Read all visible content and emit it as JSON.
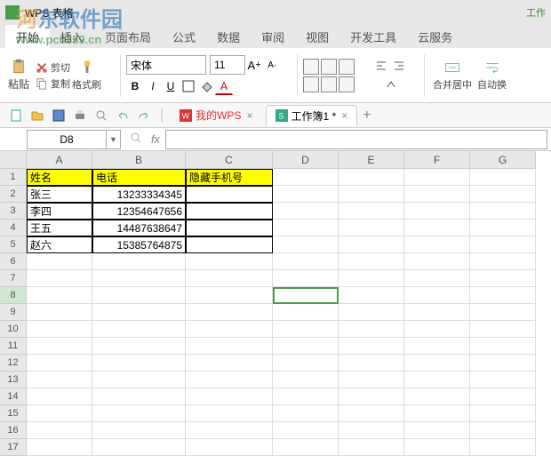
{
  "app": {
    "title": "WPS 表格",
    "topRight": "工作"
  },
  "watermark": {
    "title_pre": "河",
    "title_mid": "东软件园",
    "url": "www.pc0359.cn"
  },
  "ribbon": {
    "tabs": [
      "开始",
      "插入",
      "页面布局",
      "公式",
      "数据",
      "审阅",
      "视图",
      "开发工具",
      "云服务"
    ],
    "activeTab": 0,
    "paste": "粘贴",
    "cut": "剪切",
    "copy": "复制",
    "formatPainter": "格式刷",
    "fontName": "宋体",
    "fontSize": "11",
    "merge": "合并居中",
    "wrap": "自动换"
  },
  "docTabs": {
    "wps": "我的WPS",
    "active": "工作簿1 *"
  },
  "nameBox": "D8",
  "columns": [
    "A",
    "B",
    "C",
    "D",
    "E",
    "F",
    "G"
  ],
  "rowCount": 17,
  "headerRow": {
    "a": "姓名",
    "b": "电话",
    "c": "隐藏手机号"
  },
  "dataRows": [
    {
      "a": "张三",
      "b": "13233334345"
    },
    {
      "a": "李四",
      "b": "12354647656"
    },
    {
      "a": "王五",
      "b": "14487638647"
    },
    {
      "a": "赵六",
      "b": "15385764875"
    }
  ],
  "selection": {
    "col": "D",
    "row": 8
  }
}
